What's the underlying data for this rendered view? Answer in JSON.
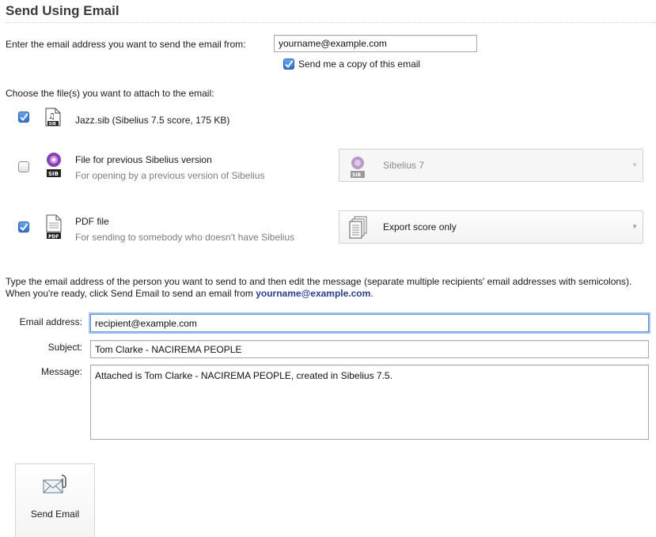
{
  "page": {
    "title": "Send Using Email"
  },
  "from": {
    "label": "Enter the email address you want to send the email from:",
    "value": "yourname@example.com",
    "copy_checked": true,
    "copy_label": "Send me a copy of this email"
  },
  "attachments": {
    "heading": "Choose the file(s) you want to attach to the email:",
    "items": [
      {
        "checked": true,
        "icon": "sibelius-score-icon",
        "title": "Jazz.sib (Sibelius 7.5 score, 175 KB)",
        "subtitle": ""
      },
      {
        "checked": false,
        "icon": "sibelius-version-icon",
        "title": "File for previous Sibelius version",
        "subtitle": "For opening by a previous version of Sibelius",
        "dropdown": {
          "value": "Sibelius 7",
          "disabled": true,
          "icon": "sibelius-version-icon"
        }
      },
      {
        "checked": true,
        "icon": "pdf-file-icon",
        "title": "PDF file",
        "subtitle": "For sending to somebody who doesn't have Sibelius",
        "dropdown": {
          "value": "Export score only",
          "disabled": false,
          "icon": "pages-icon"
        }
      }
    ]
  },
  "instructions": {
    "text_before": "Type the email address of the person you want to send to and then edit the message (separate multiple recipients' email addresses with semicolons). When you're ready, click Send Email to send an email from ",
    "email": "yourname@example.com",
    "text_after": "."
  },
  "form": {
    "email_label": "Email address:",
    "email_value": "recipient@example.com",
    "subject_label": "Subject:",
    "subject_value": "Tom Clarke - NACIREMA PEOPLE",
    "message_label": "Message:",
    "message_value": "Attached is Tom Clarke - NACIREMA PEOPLE, created in Sibelius 7.5."
  },
  "send_button": {
    "label": "Send Email",
    "icon": "envelope-attachment-icon"
  },
  "colors": {
    "accent": "#2e6fd0",
    "link_emphasis": "#2a3f8f",
    "focus_ring": "#a7c5ef"
  }
}
